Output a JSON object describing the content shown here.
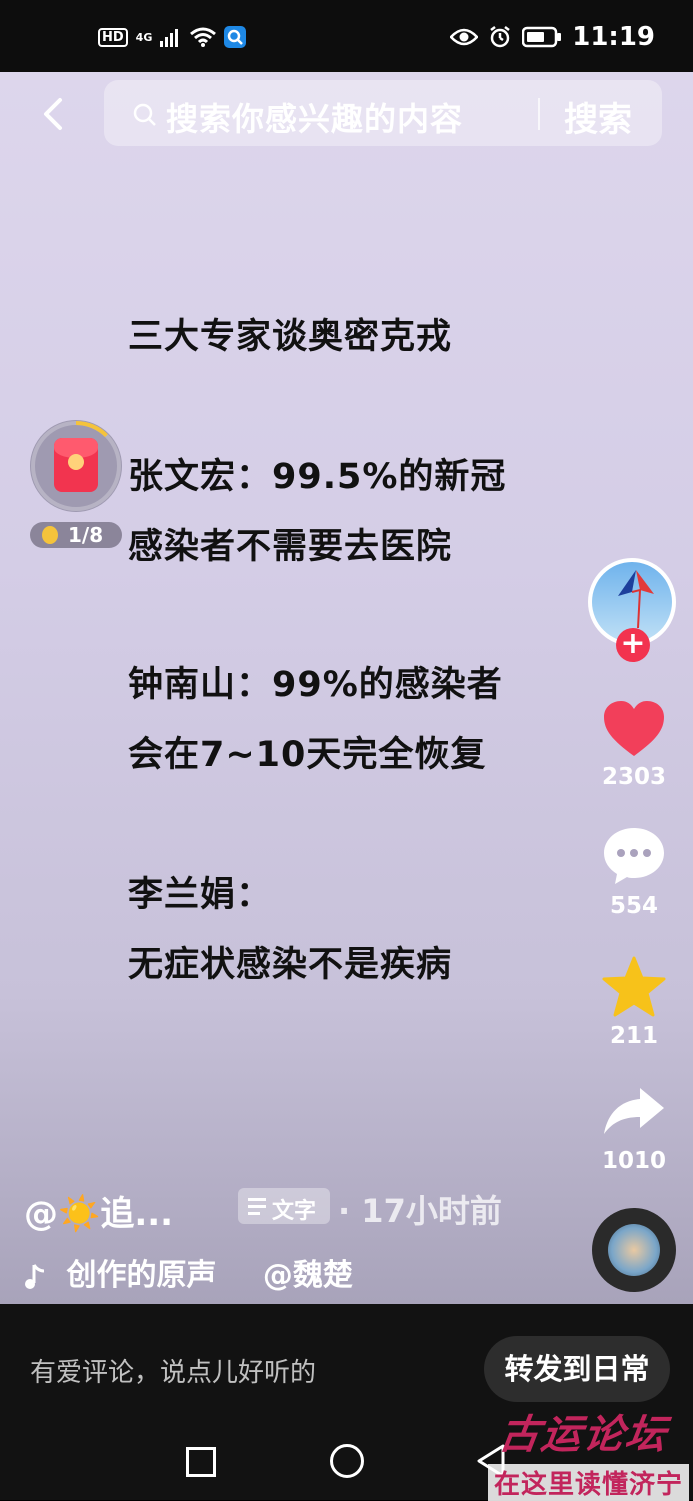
{
  "status_bar": {
    "hd_label": "HD",
    "network_label": "4G",
    "time": "11:19"
  },
  "search": {
    "placeholder": "搜索你感兴趣的内容",
    "button_label": "搜索"
  },
  "video_text": {
    "title": "三大专家谈奥密克戎",
    "lines": [
      "张文宏：99.5%的新冠",
      "感染者不需要去医院",
      "钟南山：99%的感染者",
      "会在7~10天完全恢复",
      "李兰娟：",
      "无症状感染不是疾病"
    ]
  },
  "red_packet": {
    "progress_label": "1/8",
    "progress_fraction": 0.125
  },
  "actions": {
    "like_count": "2303",
    "comment_count": "554",
    "favorite_count": "211",
    "share_count": "1010",
    "follow_label": "+"
  },
  "post_info": {
    "username": "@☀️追...",
    "tag_label": "文字",
    "time_ago": "· 17小时前",
    "music_label": "创作的原声",
    "music_author": "@魏楚"
  },
  "bottom_bar": {
    "comment_placeholder": "有爱评论，说点儿好听的",
    "forward_label": "转发到日常"
  },
  "watermark": {
    "line1": "古运论坛",
    "line2": "在这里读懂济宁"
  },
  "colors": {
    "video_bg": "#d8d1ea",
    "like_red": "#f23f5a",
    "star_yellow": "#f7c21a",
    "watermark": "#c2255c"
  }
}
